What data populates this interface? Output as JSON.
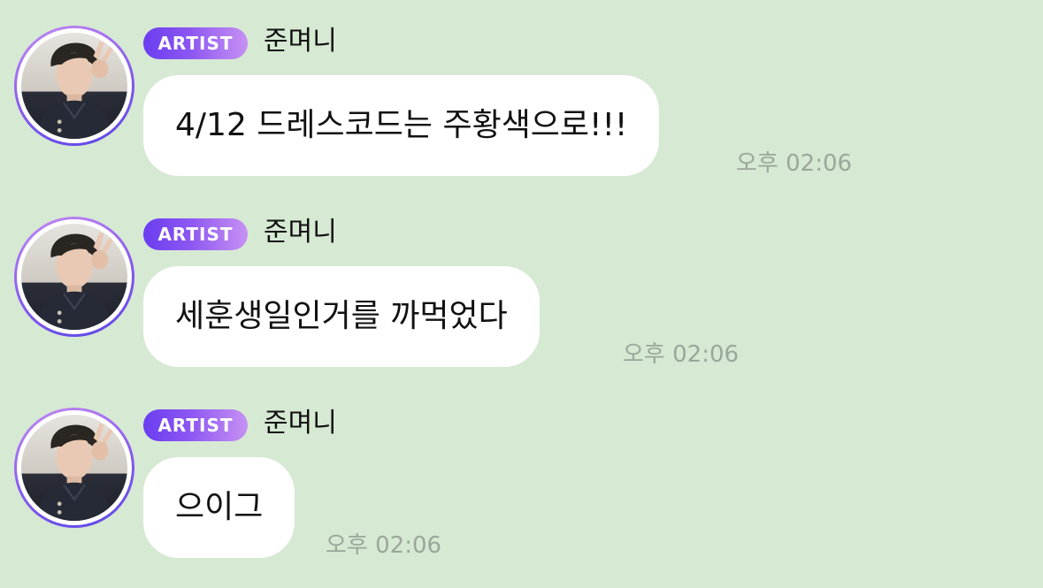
{
  "colors": {
    "background": "#d6e9d3",
    "bubble": "#ffffff",
    "badge_gradient_start": "#6a3df0",
    "badge_gradient_end": "#c691f3",
    "timestamp": "#9aa79a"
  },
  "messages": [
    {
      "badge": "ARTIST",
      "sender": "준며니",
      "text": "4/12 드레스코드는 주황색으로!!!",
      "time": "오후 02:06",
      "avatar_icon": "artist-avatar"
    },
    {
      "badge": "ARTIST",
      "sender": "준며니",
      "text": "세훈생일인거를 까먹었다",
      "time": "오후 02:06",
      "avatar_icon": "artist-avatar"
    },
    {
      "badge": "ARTIST",
      "sender": "준며니",
      "text": "으이그",
      "time": "오후 02:06",
      "avatar_icon": "artist-avatar"
    }
  ]
}
